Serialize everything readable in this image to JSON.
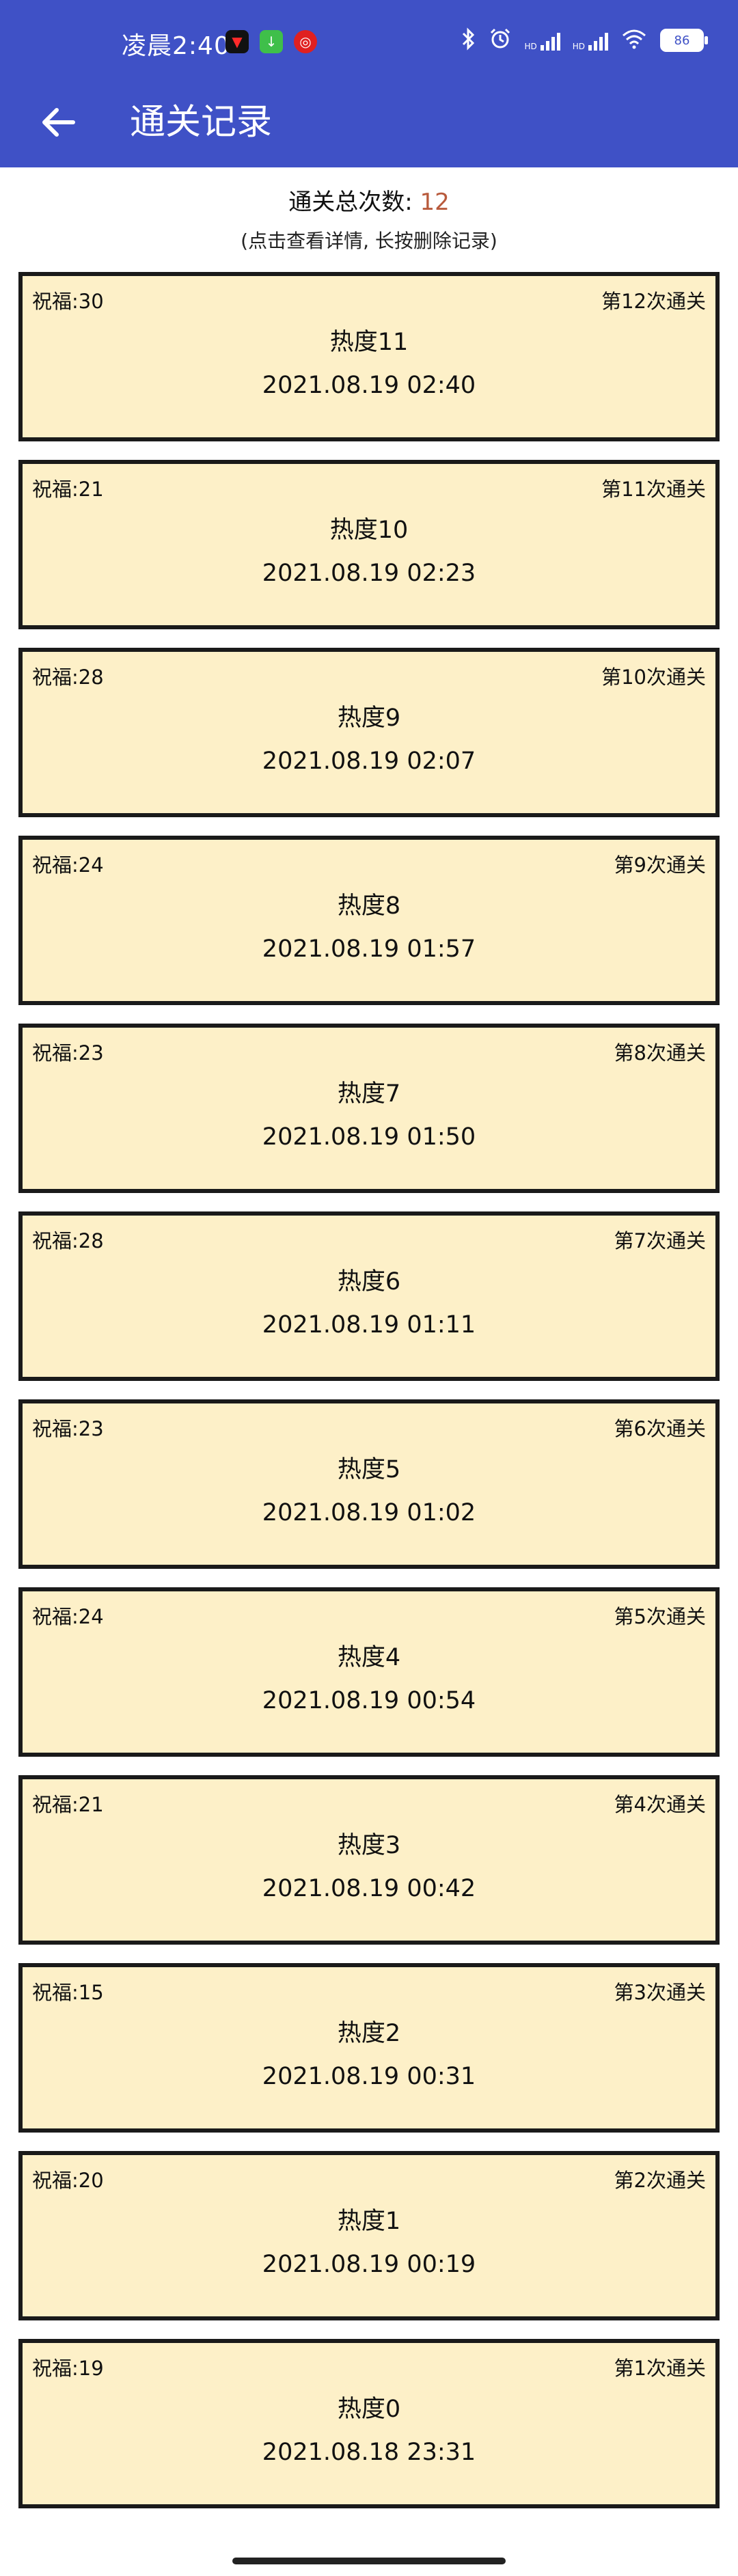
{
  "status_bar": {
    "time": "凌晨2:40",
    "battery": "86",
    "hd1": "HD",
    "hd2": "HD"
  },
  "app_bar": {
    "title": "通关记录"
  },
  "summary": {
    "label": "通关总次数: ",
    "count": "12",
    "hint": "(点击查看详情, 长按删除记录)"
  },
  "records": [
    {
      "bless": "祝福:30",
      "order": "第12次通关",
      "heat": "热度11",
      "time": "2021.08.19 02:40"
    },
    {
      "bless": "祝福:21",
      "order": "第11次通关",
      "heat": "热度10",
      "time": "2021.08.19 02:23"
    },
    {
      "bless": "祝福:28",
      "order": "第10次通关",
      "heat": "热度9",
      "time": "2021.08.19 02:07"
    },
    {
      "bless": "祝福:24",
      "order": "第9次通关",
      "heat": "热度8",
      "time": "2021.08.19 01:57"
    },
    {
      "bless": "祝福:23",
      "order": "第8次通关",
      "heat": "热度7",
      "time": "2021.08.19 01:50"
    },
    {
      "bless": "祝福:28",
      "order": "第7次通关",
      "heat": "热度6",
      "time": "2021.08.19 01:11"
    },
    {
      "bless": "祝福:23",
      "order": "第6次通关",
      "heat": "热度5",
      "time": "2021.08.19 01:02"
    },
    {
      "bless": "祝福:24",
      "order": "第5次通关",
      "heat": "热度4",
      "time": "2021.08.19 00:54"
    },
    {
      "bless": "祝福:21",
      "order": "第4次通关",
      "heat": "热度3",
      "time": "2021.08.19 00:42"
    },
    {
      "bless": "祝福:15",
      "order": "第3次通关",
      "heat": "热度2",
      "time": "2021.08.19 00:31"
    },
    {
      "bless": "祝福:20",
      "order": "第2次通关",
      "heat": "热度1",
      "time": "2021.08.19 00:19"
    },
    {
      "bless": "祝福:19",
      "order": "第1次通关",
      "heat": "热度0",
      "time": "2021.08.18 23:31"
    }
  ],
  "colors": {
    "appbar": "#3f51c6",
    "card_bg": "#fdf0c8",
    "card_border": "#1a1a1a",
    "count": "#b85a3c"
  },
  "icons": {
    "back": "arrow-left-icon",
    "bluetooth": "bluetooth-icon",
    "alarm": "alarm-icon",
    "signal": "signal-icon",
    "wifi": "wifi-icon",
    "battery": "battery-icon"
  }
}
